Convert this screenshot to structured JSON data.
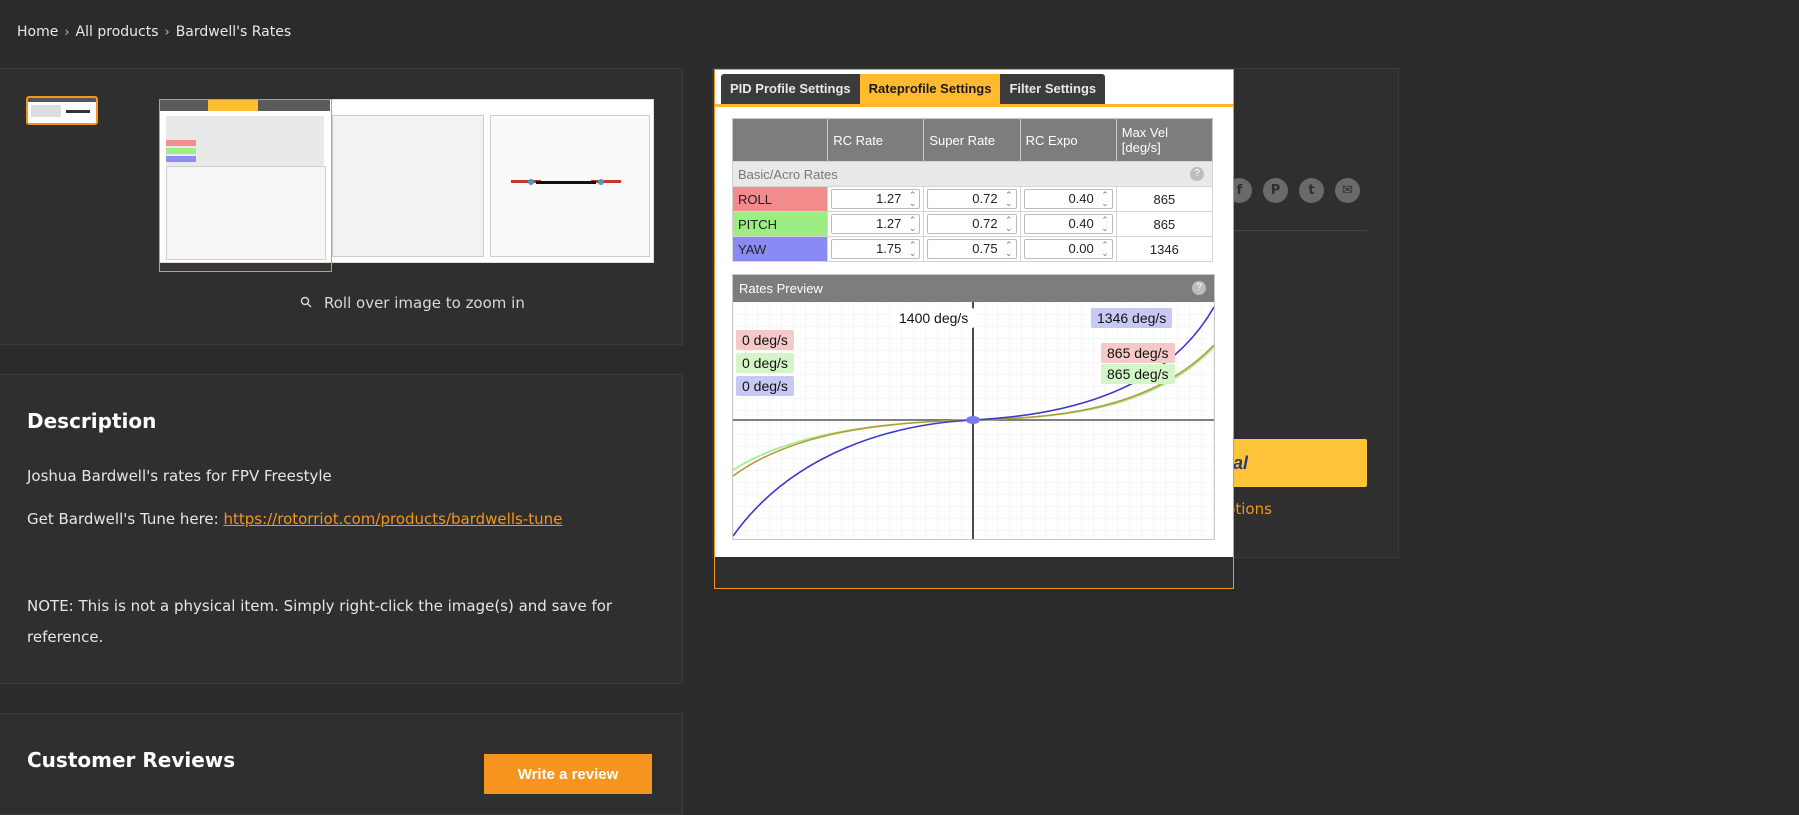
{
  "breadcrumb": {
    "items": [
      "Home",
      "All products",
      "Bardwell's Rates"
    ],
    "separator": "›"
  },
  "gallery": {
    "zoom_hint": "Roll over image to zoom in"
  },
  "description": {
    "title": "Description",
    "line1": "Joshua Bardwell's rates for FPV Freestyle",
    "line2_prefix": "Get Bardwell's Tune here: ",
    "line2_link": "https://rotorriot.com/products/bardwells-tune",
    "note": "NOTE: This is not a physical item. Simply right-click the image(s) and save for reference."
  },
  "reviews": {
    "title": "Customer Reviews",
    "write_review_label": "Write a review"
  },
  "purchase": {
    "paypal_visible": "yPal",
    "more_options_visible": "t options"
  },
  "share_icons": [
    "facebook-icon",
    "pinterest-icon",
    "twitter-icon",
    "email-icon"
  ],
  "zoom": {
    "tabs": [
      "PID Profile Settings",
      "Rateprofile Settings",
      "Filter Settings"
    ],
    "active_tab": "Rateprofile Settings",
    "table": {
      "headers": [
        "",
        "RC Rate",
        "Super Rate",
        "RC Expo",
        "Max Vel [deg/s]"
      ],
      "section": "Basic/Acro Rates",
      "rows": [
        {
          "axis": "ROLL",
          "rc_rate": "1.27",
          "super_rate": "0.72",
          "rc_expo": "0.40",
          "max_vel": "865",
          "color": "#f28b8b"
        },
        {
          "axis": "PITCH",
          "rc_rate": "1.27",
          "super_rate": "0.72",
          "rc_expo": "0.40",
          "max_vel": "865",
          "color": "#9ded83"
        },
        {
          "axis": "YAW",
          "rc_rate": "1.75",
          "super_rate": "0.75",
          "rc_expo": "0.00",
          "max_vel": "1346",
          "color": "#8a8af5"
        }
      ]
    },
    "preview": {
      "title": "Rates Preview",
      "scale_label": "1400 deg/s",
      "left_labels": [
        "0 deg/s",
        "0 deg/s",
        "0 deg/s"
      ],
      "right_labels": [
        "1346 deg/s",
        "865 deg/s",
        "865 deg/s"
      ]
    }
  },
  "colors": {
    "accent": "#f7941d",
    "tab_active": "#ffbb2d",
    "roll": "#f28b8b",
    "pitch": "#9ded83",
    "yaw": "#8a8af5",
    "paypal": "#ffc439"
  }
}
